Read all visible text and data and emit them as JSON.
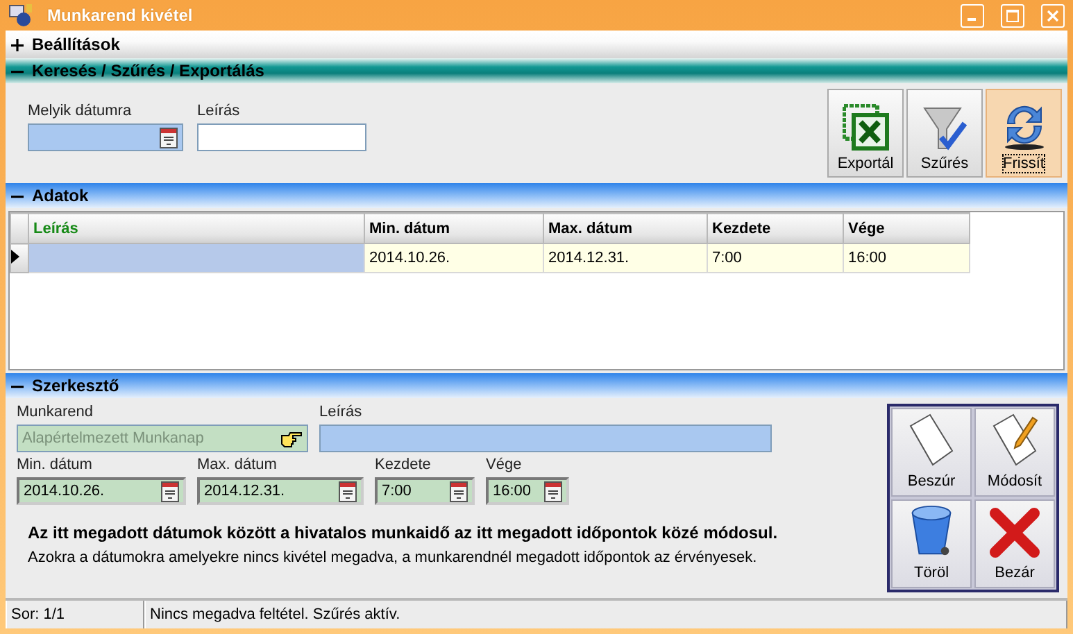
{
  "window": {
    "title": "Munkarend kivétel"
  },
  "settings_section": {
    "title": "Beállítások",
    "expanded": false
  },
  "search_section": {
    "title": "Keresés / Szűrés / Exportálás",
    "expanded": true,
    "fields": [
      {
        "label": "Melyik dátumra",
        "kind": "date",
        "highlighted": true
      },
      {
        "label": "Leírás",
        "kind": "text",
        "highlighted": false
      }
    ],
    "buttons": [
      {
        "label": "Exportál",
        "kind": "excel",
        "focused": false
      },
      {
        "label": "Szűrés",
        "kind": "filter",
        "focused": false
      },
      {
        "label": "Frissít",
        "kind": "refresh",
        "focused": true
      }
    ]
  },
  "data_section": {
    "title": "Adatok",
    "expanded": true,
    "columns": [
      {
        "label": "Leírás",
        "sorted": true
      },
      {
        "label": "Min. dátum",
        "sorted": false
      },
      {
        "label": "Max. dátum",
        "sorted": false
      },
      {
        "label": "Kezdete",
        "sorted": false
      },
      {
        "label": "Vége",
        "sorted": false
      }
    ],
    "rows": [
      {
        "selected": true,
        "cells": [
          {
            "focused": true
          },
          {
            "text": "2014.10.26.",
            "focused": false
          },
          {
            "text": "2014.12.31.",
            "focused": false
          },
          {
            "text": "7:00",
            "focused": false
          },
          {
            "text": "16:00",
            "focused": false
          }
        ]
      }
    ]
  },
  "editor_section": {
    "title": "Szerkesztő",
    "expanded": true,
    "rows": [
      [
        {
          "label": "Munkarend",
          "kind": "lookup",
          "value": "Alapértelmezett Munkanap",
          "disabled": true,
          "highlighted": false
        },
        {
          "label": "Leírás",
          "kind": "text",
          "disabled": false,
          "highlighted": true
        }
      ],
      [
        {
          "label": "Min. dátum",
          "kind": "date",
          "value": "2014.10.26."
        },
        {
          "label": "Max. dátum",
          "kind": "date",
          "value": "2014.12.31."
        },
        {
          "label": "Kezdete",
          "kind": "date",
          "value": "7:00"
        },
        {
          "label": "Vége",
          "kind": "date",
          "value": "16:00"
        }
      ]
    ],
    "note_bold": "Az itt megadott dátumok között a hivatalos munkaidő az itt megadott időpontok közé módosul.",
    "note": "Azokra a dátumokra amelyekre nincs kivétel megadva, a munkarendnél megadott időpontok az érvényesek.",
    "buttons": [
      {
        "label": "Beszúr",
        "kind": "page"
      },
      {
        "label": "Módosít",
        "kind": "edit"
      },
      {
        "label": "Töröl",
        "kind": "trash"
      },
      {
        "label": "Bezár",
        "kind": "close"
      }
    ]
  },
  "status_bar": [
    "Sor: 1/1",
    "Nincs megadva feltétel. Szűrés aktív."
  ]
}
